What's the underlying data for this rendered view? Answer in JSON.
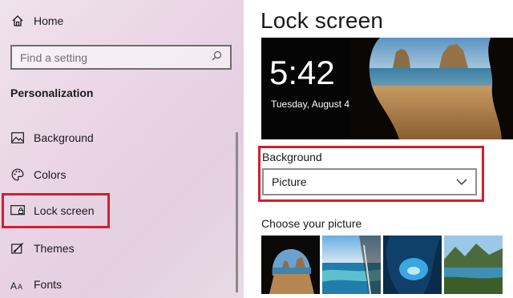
{
  "sidebar": {
    "home_label": "Home",
    "search_placeholder": "Find a setting",
    "section_title": "Personalization",
    "items": [
      {
        "label": "Background",
        "icon": "image-icon"
      },
      {
        "label": "Colors",
        "icon": "palette-icon"
      },
      {
        "label": "Lock screen",
        "icon": "lock-screen-icon",
        "active": true
      },
      {
        "label": "Themes",
        "icon": "brush-icon"
      },
      {
        "label": "Fonts",
        "icon": "fonts-icon"
      }
    ]
  },
  "main": {
    "title": "Lock screen",
    "preview": {
      "time": "5:42",
      "date": "Tuesday, August 4"
    },
    "background_label": "Background",
    "background_value": "Picture",
    "choose_label": "Choose your picture"
  },
  "colors": {
    "highlight_red": "#d0202e",
    "sidebar_bg": "#ead5e6"
  }
}
